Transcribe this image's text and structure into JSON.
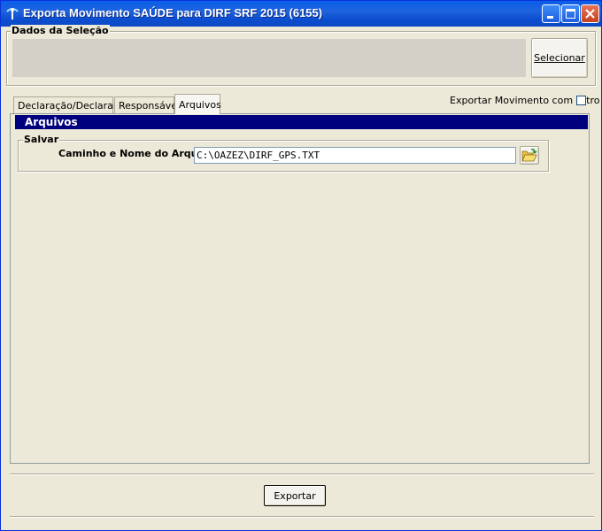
{
  "window": {
    "title": "Exporta Movimento SAÚDE para DIRF SRF 2015 (6155)",
    "app_icon": "app-icon",
    "controls": {
      "minimize": "minimize-icon",
      "maximize": "maximize-icon",
      "close": "close-icon"
    }
  },
  "selection": {
    "group_title": "Dados da Seleção",
    "select_button": "Selecionar"
  },
  "tabs": [
    {
      "label": "Declaração/Declarante",
      "active": false
    },
    {
      "label": "Responsável",
      "active": false
    },
    {
      "label": "Arquivos",
      "active": true
    }
  ],
  "filter": {
    "label": "Exportar Movimento com Filtro",
    "checked": false
  },
  "panel": {
    "header": "Arquivos",
    "save_group": "Salvar",
    "path_label": "Caminho e Nome do Arquivo",
    "path_value": "C:\\OAZEZ\\DIRF_GPS.TXT",
    "browse_icon": "folder-open-icon"
  },
  "footer": {
    "export_button": "Exportar"
  },
  "colors": {
    "titlebar": "#0a5ee8",
    "face": "#ece9d8",
    "header_bar": "#00007f"
  }
}
